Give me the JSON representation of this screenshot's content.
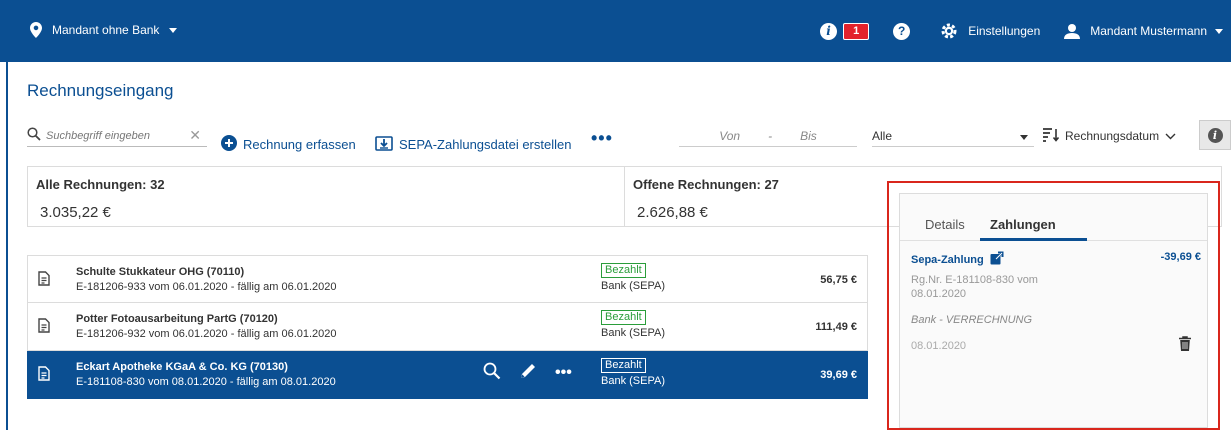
{
  "topbar": {
    "client_label": "Mandant ohne Bank",
    "notification_count": "1",
    "settings_label": "Einstellungen",
    "user_label": "Mandant Mustermann"
  },
  "page": {
    "title": "Rechnungseingang"
  },
  "toolbar": {
    "search_placeholder": "Suchbegriff eingeben",
    "add_invoice_label": "Rechnung erfassen",
    "sepa_file_label": "SEPA-Zahlungsdatei erstellen",
    "range_from_placeholder": "Von",
    "range_separator": "-",
    "range_to_placeholder": "Bis",
    "filter_value": "Alle",
    "sort_label": "Rechnungsdatum"
  },
  "summary": {
    "all_label": "Alle Rechnungen: 32",
    "all_value": "3.035,22 €",
    "open_label": "Offene Rechnungen: 27",
    "open_value": "2.626,88 €"
  },
  "invoices": [
    {
      "name": "Schulte Stukkateur OHG (70110)",
      "detail": "E-181206-933 vom 06.01.2020 - fällig am 06.01.2020",
      "status": "Bezahlt",
      "method": "Bank (SEPA)",
      "amount": "56,75 €"
    },
    {
      "name": "Potter Fotoausarbeitung PartG (70120)",
      "detail": "E-181206-932 vom 06.01.2020 - fällig am 06.01.2020",
      "status": "Bezahlt",
      "method": "Bank (SEPA)",
      "amount": "111,49 €"
    },
    {
      "name": "Eckart Apotheke KGaA & Co. KG (70130)",
      "detail": "E-181108-830 vom 08.01.2020 - fällig am 08.01.2020",
      "status": "Bezahlt",
      "method": "Bank (SEPA)",
      "amount": "39,69 €"
    }
  ],
  "panel": {
    "tab_details": "Details",
    "tab_payments": "Zahlungen",
    "payment_title": "Sepa-Zahlung",
    "payment_amount": "-39,69 €",
    "payment_ref": "Rg.Nr. E-181108-830 vom 08.01.2020",
    "payment_bank": "Bank - VERRECHNUNG",
    "payment_date": "08.01.2020"
  },
  "colors": {
    "brand": "#0b4f92",
    "status_paid": "#2a9d3a",
    "badge": "#e3222b",
    "highlight_border": "#d9261c"
  }
}
